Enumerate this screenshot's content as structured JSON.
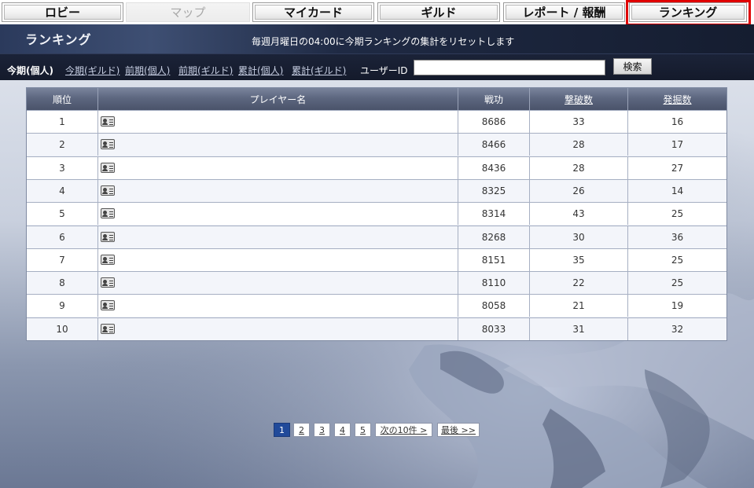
{
  "nav": {
    "tabs": [
      {
        "label": "ロビー"
      },
      {
        "label": "マップ"
      },
      {
        "label": "マイカード"
      },
      {
        "label": "ギルド"
      },
      {
        "label": "レポート / 報酬"
      },
      {
        "label": "ランキング"
      }
    ]
  },
  "header": {
    "title": "ランキング",
    "note": "毎週月曜日の04:00に今期ランキングの集計をリセットします"
  },
  "filters": {
    "current": "今期(個人)",
    "links": [
      "今期(ギルド)",
      "前期(個人)",
      "前期(ギルド)",
      "累計(個人)",
      "累計(ギルド)"
    ],
    "userid_label": "ユーザーID",
    "userid_value": "",
    "search_label": "検索"
  },
  "table": {
    "headers": [
      "順位",
      "プレイヤー名",
      "戦功",
      "撃破数",
      "発掘数"
    ],
    "rows": [
      {
        "rank": "1",
        "name": "",
        "score": "8686",
        "kills": "33",
        "digs": "16"
      },
      {
        "rank": "2",
        "name": "",
        "score": "8466",
        "kills": "28",
        "digs": "17"
      },
      {
        "rank": "3",
        "name": "",
        "score": "8436",
        "kills": "28",
        "digs": "27"
      },
      {
        "rank": "4",
        "name": "",
        "score": "8325",
        "kills": "26",
        "digs": "14"
      },
      {
        "rank": "5",
        "name": "",
        "score": "8314",
        "kills": "43",
        "digs": "25"
      },
      {
        "rank": "6",
        "name": "",
        "score": "8268",
        "kills": "30",
        "digs": "36"
      },
      {
        "rank": "7",
        "name": "",
        "score": "8151",
        "kills": "35",
        "digs": "25"
      },
      {
        "rank": "8",
        "name": "",
        "score": "8110",
        "kills": "22",
        "digs": "25"
      },
      {
        "rank": "9",
        "name": "",
        "score": "8058",
        "kills": "21",
        "digs": "19"
      },
      {
        "rank": "10",
        "name": "",
        "score": "8033",
        "kills": "31",
        "digs": "32"
      }
    ]
  },
  "pagination": {
    "pages": [
      "1",
      "2",
      "3",
      "4",
      "5"
    ],
    "current": "1",
    "next_label": "次の10件 >",
    "last_label": "最後 >>"
  },
  "colors": {
    "highlight": "#e00000",
    "current_page": "#214a9a",
    "header_band": "#1f2a44"
  }
}
